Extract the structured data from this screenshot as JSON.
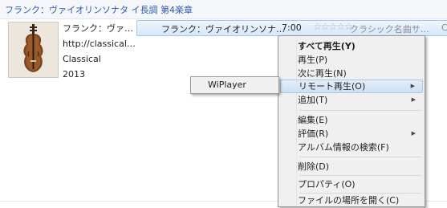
{
  "header": {
    "title": "フランク：ヴァイオリンソナタ イ長調 第4楽章"
  },
  "album": {
    "artist": "フランク：ヴァ…",
    "url": "http://classical…",
    "genre": "Classical",
    "year": "2013"
  },
  "track": {
    "title": "フランク：ヴァイオリンソナ…",
    "duration": "7:00",
    "rating_stars": "☆☆☆☆☆",
    "genre": "クラシック名曲サ…",
    "extra": "Ce"
  },
  "context_menu": {
    "items": [
      {
        "label": "すべて再生(Y)"
      },
      {
        "label": "再生(P)"
      },
      {
        "label": "次に再生(N)"
      },
      {
        "label": "リモート再生(O)"
      },
      {
        "label": "追加(T)"
      },
      {
        "label": "編集(E)"
      },
      {
        "label": "評価(R)"
      },
      {
        "label": "アルバム情報の検索(F)"
      },
      {
        "label": "削除(D)"
      },
      {
        "label": "プロパティ(O)"
      },
      {
        "label": "ファイルの場所を開く(C)"
      }
    ],
    "submenu_arrow": "▶"
  },
  "remote_submenu": {
    "items": [
      {
        "label": "WiPlayer"
      }
    ]
  },
  "colors": {
    "header_title": "#2b5aa6",
    "selection": "#d7e7fb",
    "menu_bg": "#f0f0f0"
  }
}
